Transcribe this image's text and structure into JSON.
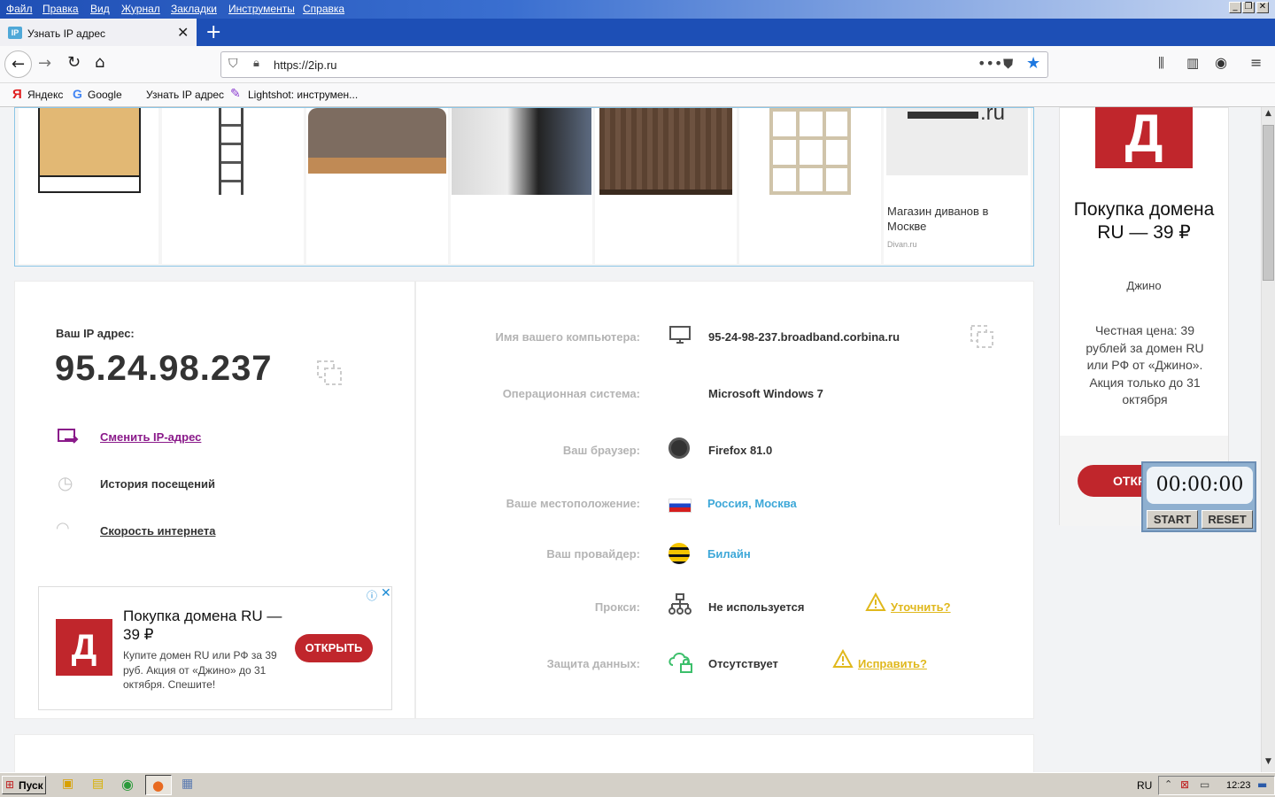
{
  "menu": [
    "Файл",
    "Правка",
    "Вид",
    "Журнал",
    "Закладки",
    "Инструменты",
    "Справка"
  ],
  "tab": {
    "title": "Узнать IP адрес"
  },
  "url": "https://2ip.ru",
  "bookmarks": [
    "Яндекс",
    "Google",
    "Узнать IP адрес",
    "Lightshot: инструмен..."
  ],
  "ad_strip": {
    "caption": "Магазин диванов в Москве",
    "domain": "Divan.ru"
  },
  "ip": {
    "label": "Ваш IP адрес:",
    "value": "95.24.98.237",
    "actions": [
      "Сменить IP-адрес",
      "История посещений",
      "Скорость интернета"
    ]
  },
  "info_rows": [
    {
      "label": "Имя вашего компьютера:",
      "value": "95-24-98-237.broadband.corbina.ru",
      "icon": "monitor-icon"
    },
    {
      "label": "Операционная система:",
      "value": "Microsoft Windows 7",
      "icon": ""
    },
    {
      "label": "Ваш браузер:",
      "value": "Firefox 81.0",
      "icon": "firefox-icon"
    },
    {
      "label": "Ваше местоположение:",
      "value": "Россия, Москва",
      "icon": "russia-flag-icon"
    },
    {
      "label": "Ваш провайдер:",
      "value": "Билайн",
      "icon": "beeline-icon"
    },
    {
      "label": "Прокси:",
      "value": "Не используется",
      "icon": "network-icon",
      "action": "Уточнить?"
    },
    {
      "label": "Защита данных:",
      "value": "Отсутствует",
      "icon": "cloud-lock-icon",
      "action": "Исправить?"
    }
  ],
  "ad_left": {
    "logo": "Д",
    "title": "Покупка домена RU — 39 ₽",
    "text": "Купите домен RU или РФ за 39 руб. Акция от «Джино» до 31 октября. Спешите!",
    "button": "ОТКРЫТЬ"
  },
  "ad_right": {
    "logo": "Д",
    "title": "Покупка домена RU — 39 ₽",
    "brand": "Джино",
    "text": "Честная цена: 39 рублей за домен RU или РФ от «Джино». Акция только до 31 октября",
    "button": "ОТКРЫТЬ"
  },
  "timer": {
    "display": "00:00:00",
    "start": "START",
    "reset": "RESET"
  },
  "taskbar": {
    "start": "Пуск",
    "lang": "RU",
    "time": "12:23"
  },
  "colors": {
    "accent_red": "#c0262c",
    "link_purple": "#8a1a8a",
    "link_blue": "#3ea8d8",
    "warn_yellow": "#e0b81c"
  }
}
